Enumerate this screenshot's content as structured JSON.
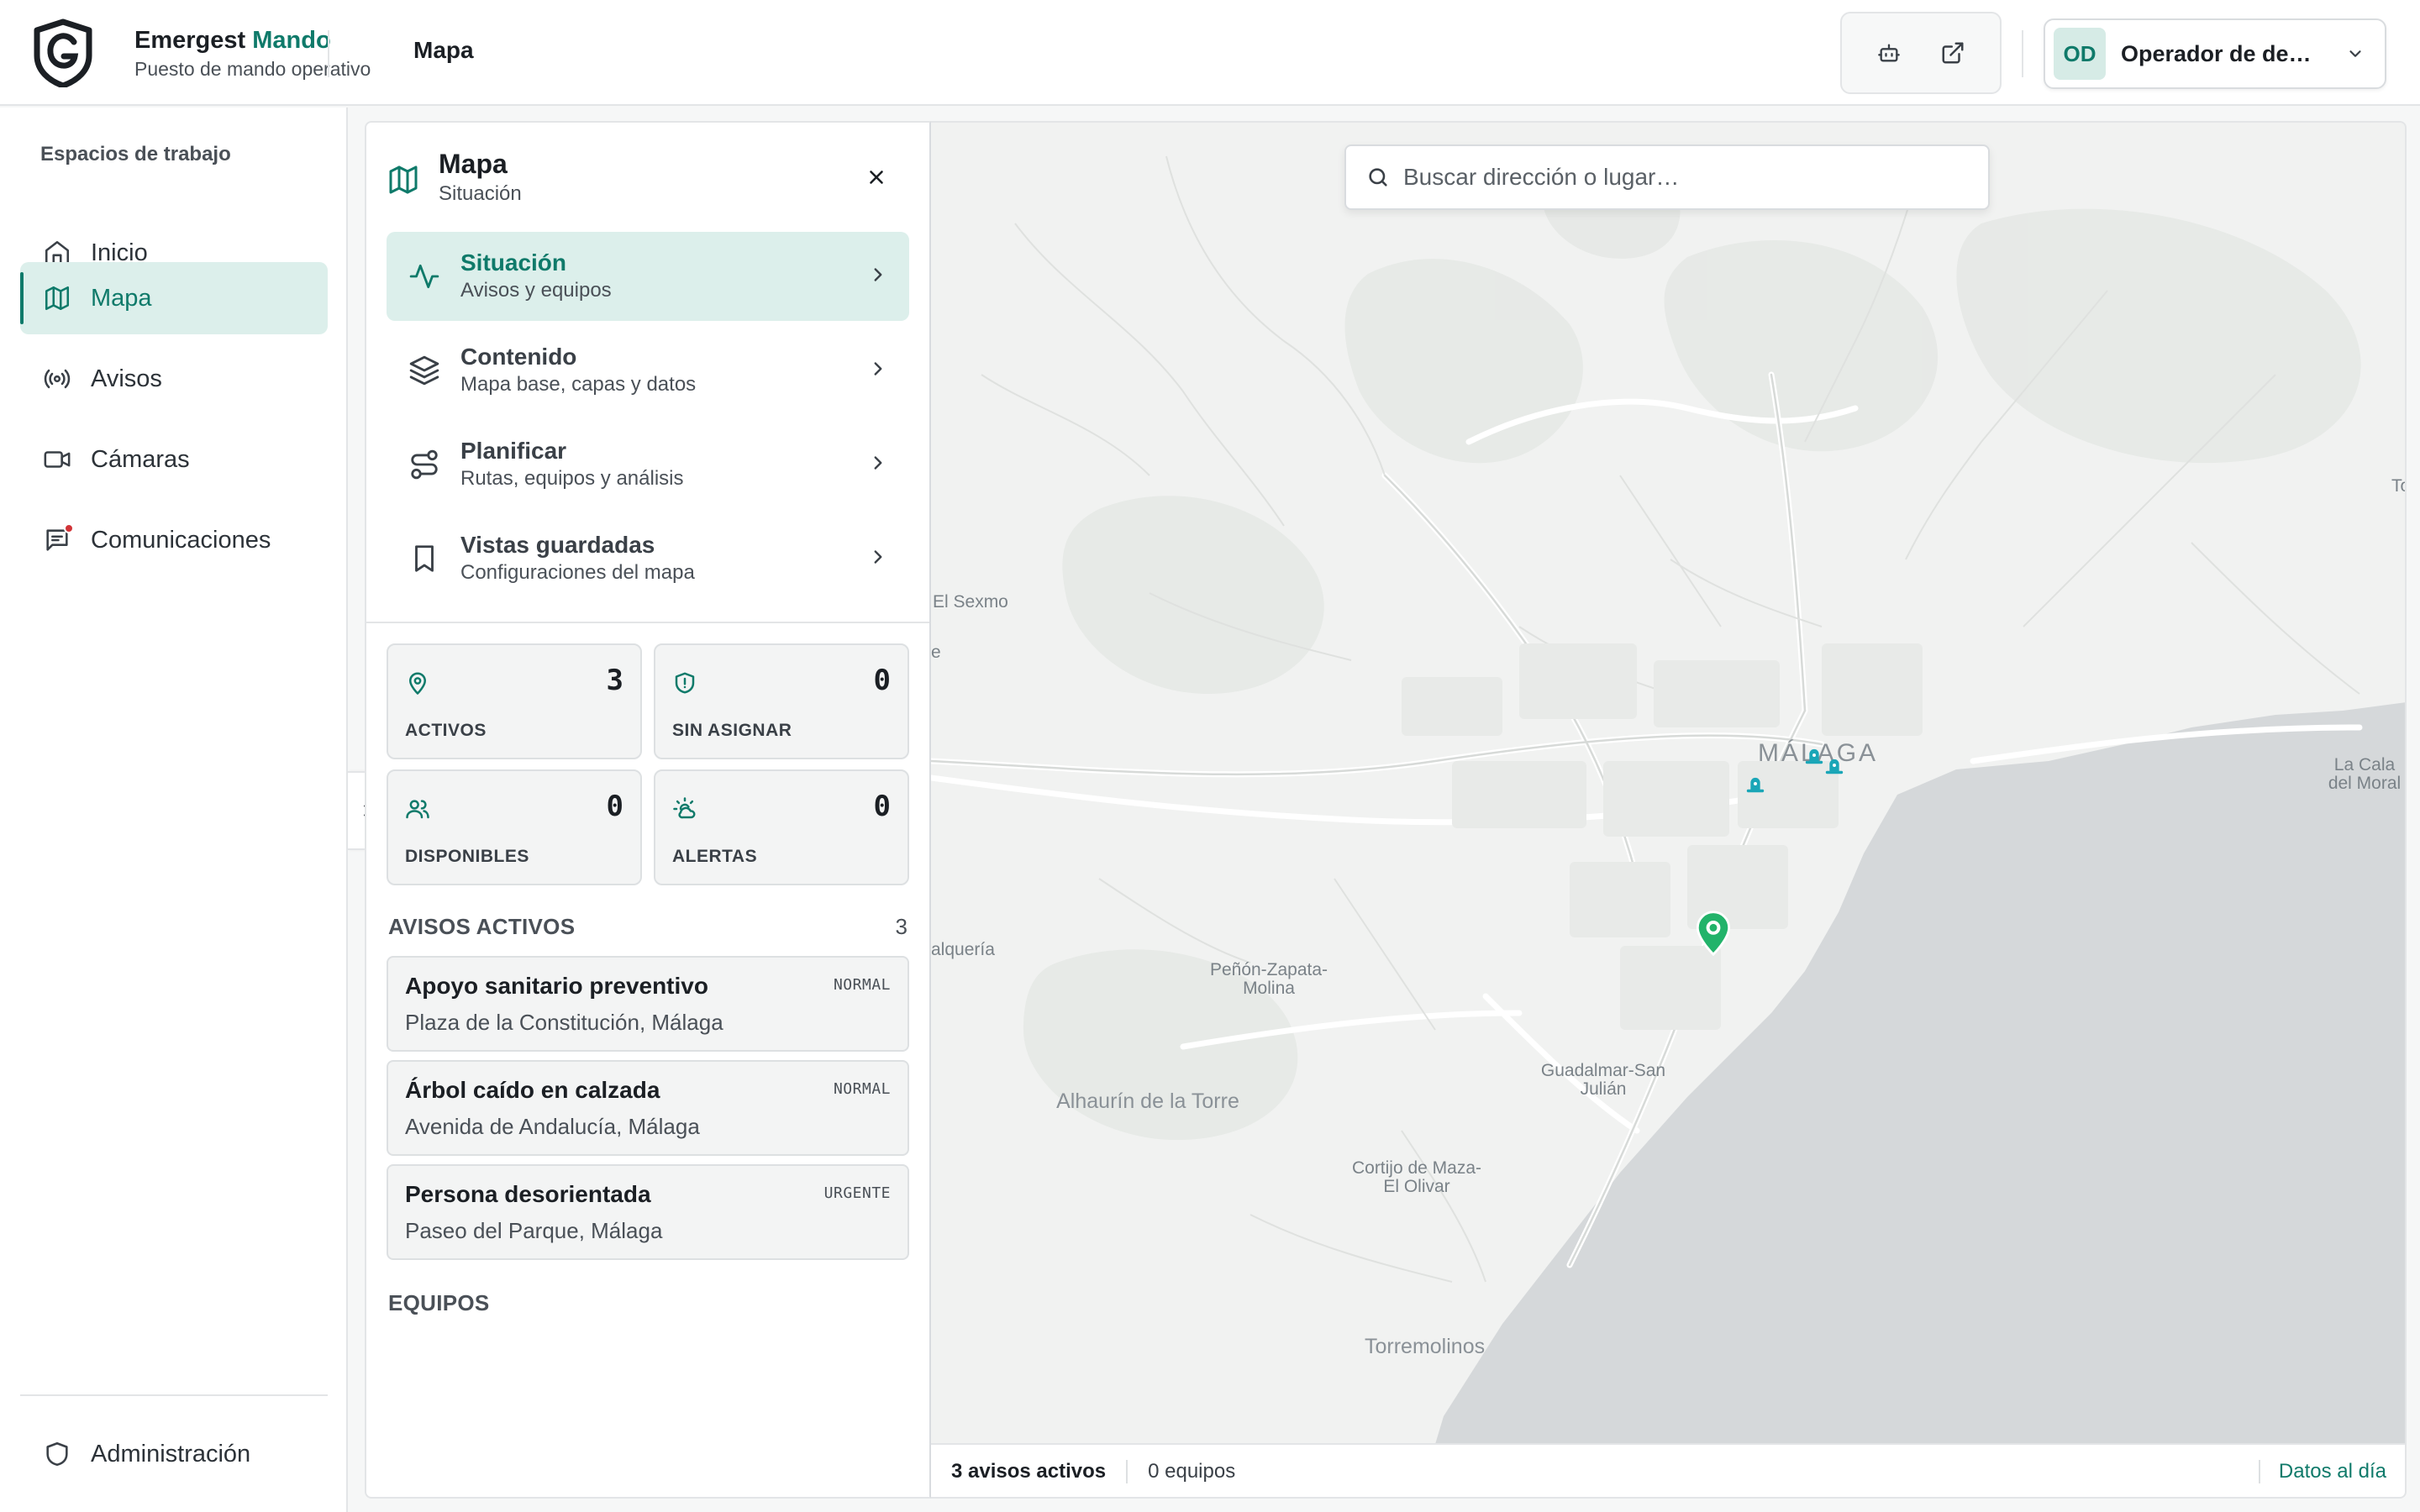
{
  "header": {
    "brand_name": "Emergest",
    "brand_accent": "Mando",
    "brand_subtitle": "Puesto de mando operativo",
    "page_title": "Mapa",
    "user_initials": "OD",
    "user_name": "Operador de demostración"
  },
  "nav": {
    "heading": "Espacios de trabajo",
    "items": [
      {
        "label": "Inicio",
        "icon": "home-icon"
      },
      {
        "label": "Mapa",
        "icon": "map-icon",
        "active": true
      },
      {
        "label": "Avisos",
        "icon": "broadcast-icon"
      },
      {
        "label": "Cámaras",
        "icon": "video-camera-icon"
      },
      {
        "label": "Comunicaciones",
        "icon": "message-icon",
        "badge": true
      }
    ],
    "admin_label": "Administración"
  },
  "panel": {
    "title": "Mapa",
    "subtitle": "Situación",
    "menu": [
      {
        "title": "Situación",
        "subtitle": "Avisos y equipos",
        "icon": "activity-icon",
        "active": true
      },
      {
        "title": "Contenido",
        "subtitle": "Mapa base, capas y datos",
        "icon": "layers-icon"
      },
      {
        "title": "Planificar",
        "subtitle": "Rutas, equipos y análisis",
        "icon": "route-icon"
      },
      {
        "title": "Vistas guardadas",
        "subtitle": "Configuraciones del mapa",
        "icon": "bookmark-icon"
      }
    ],
    "stats": [
      {
        "label": "ACTIVOS",
        "value": "3",
        "icon": "pin-icon"
      },
      {
        "label": "SIN ASIGNAR",
        "value": "0",
        "icon": "shield-alert-icon"
      },
      {
        "label": "DISPONIBLES",
        "value": "0",
        "icon": "users-icon"
      },
      {
        "label": "ALERTAS",
        "value": "0",
        "icon": "weather-icon"
      }
    ],
    "incidents_heading": "AVISOS ACTIVOS",
    "incidents_count": "3",
    "incidents": [
      {
        "title": "Apoyo sanitario preventivo",
        "location": "Plaza de la Constitución, Málaga",
        "priority": "NORMAL"
      },
      {
        "title": "Árbol caído en calzada",
        "location": "Avenida de Andalucía, Málaga",
        "priority": "NORMAL"
      },
      {
        "title": "Persona desorientada",
        "location": "Paseo del Parque, Málaga",
        "priority": "URGENTE"
      }
    ],
    "teams_heading": "EQUIPOS"
  },
  "map": {
    "search_placeholder": "Buscar dirección o lugar…",
    "labels": [
      "El Sexmo",
      "MÁLAGA",
      "La Cala del Moral",
      "alquería",
      "Peñón-Zapata-Molina",
      "Alhaurín de la Torre",
      "Guadalmar-San Julián",
      "Cortijo de Maza-El Olivar",
      "Torremolinos",
      "To",
      "e"
    ],
    "status": {
      "incidents": "3 avisos activos",
      "teams": "0 equipos",
      "data_freshness": "Datos al día"
    }
  },
  "colors": {
    "accent": "#0f7a6a",
    "accent_soft": "#dcefeb",
    "marker_green": "#22b36a",
    "marker_teal": "#1aa6b7",
    "sea": "#d5d8da",
    "badge_red": "#d13438"
  }
}
